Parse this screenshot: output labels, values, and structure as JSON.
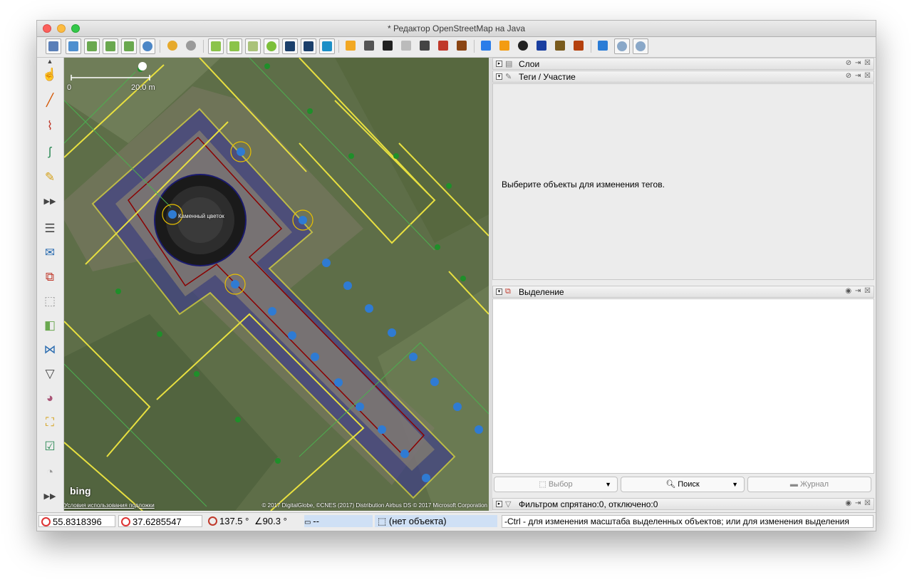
{
  "window": {
    "title": "* Редактор OpenStreetMap на Java"
  },
  "toolbar": {
    "buttons": [
      "open-file",
      "save",
      "save-as",
      "download",
      "upload",
      "preferences",
      "undo",
      "redo",
      "zoom-to-fit",
      "zoom-layer",
      "wms",
      "search",
      "split-way",
      "combine-way",
      "bing",
      "paint-tool",
      "road-tool",
      "rail-tool",
      "junction-tool",
      "gate-tool",
      "wall-tool",
      "building-tool",
      "hotel-tool",
      "shop-tool",
      "sport-tool",
      "info-tool",
      "industrial-tool",
      "peak-tool",
      "water-tool",
      "zoom-in-tool",
      "zoom-out-tool"
    ]
  },
  "map": {
    "scale_zero": "0",
    "scale_label": "20.0 m",
    "feature_label": "Каменный цветок",
    "bing_logo": "bing",
    "attribution_left": "Условия использования подложки",
    "attribution_right": "© 2017 DigitalGlobe, ©CNES (2017) Distribution Airbus DS © 2017 Microsoft Corporation"
  },
  "panels": {
    "layers": {
      "title": "Слои"
    },
    "tags": {
      "title": "Теги / Участие",
      "empty_message": "Выберите объекты для изменения тегов."
    },
    "selection": {
      "title": "Выделение"
    },
    "buttons": {
      "select": "Выбор",
      "search": "Поиск",
      "history": "Журнал"
    },
    "filter": {
      "title": "Фильтром спрятано:0, отключено:0"
    }
  },
  "status": {
    "lat": "55.8318396",
    "lon": "37.6285547",
    "heading": "137.5 °",
    "angle": "90.3 °",
    "distance": "--",
    "object": "(нет объекта)",
    "help": "-Ctrl - для изменения масштаба выделенных объектов; или для изменения выделения"
  },
  "colors": {
    "accent": "#d33a3a",
    "selection_fill": "#3b3b8c"
  }
}
